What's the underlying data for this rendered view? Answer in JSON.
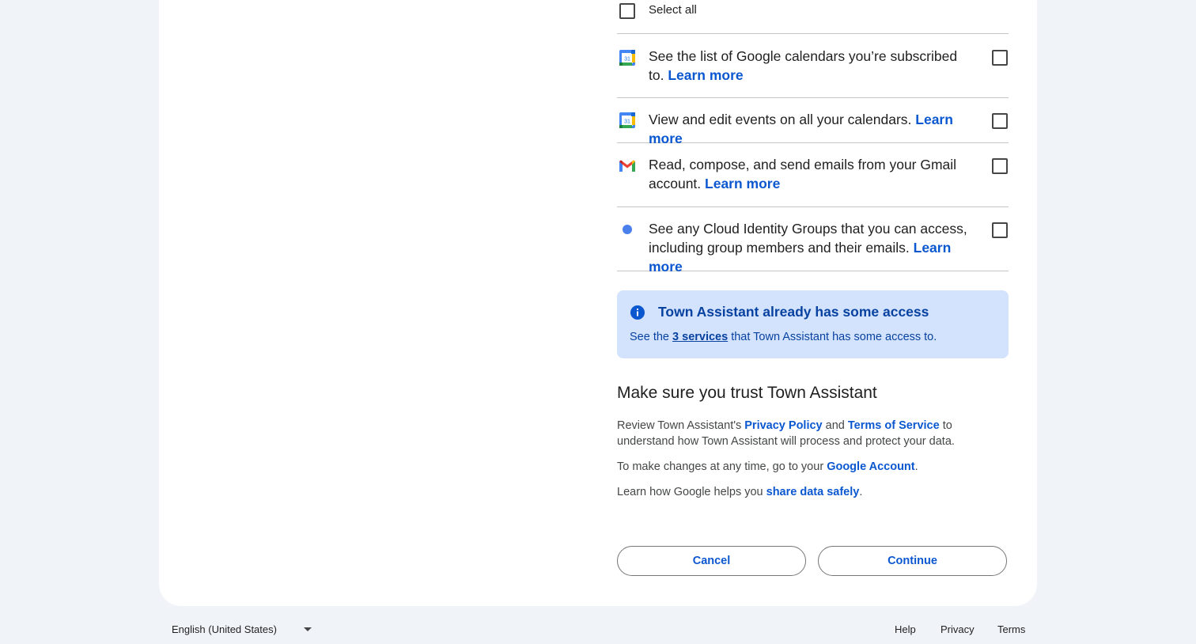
{
  "select_all_label": "Select all",
  "scopes": [
    {
      "text": "See the list of Google calendars you’re subscribed to.",
      "link": "Learn more",
      "icon": "google-calendar-icon"
    },
    {
      "text": "View and edit events on all your calendars.",
      "link": "Learn more",
      "icon": "google-calendar-icon"
    },
    {
      "text": "Read, compose, and send emails from your Gmail account.",
      "link": "Learn more",
      "icon": "gmail-icon"
    },
    {
      "text": "See any Cloud Identity Groups that you can access, including group members and their emails.",
      "link": "Learn more",
      "icon": "blue-dot-icon"
    }
  ],
  "calendar_icon_day": "31",
  "info_box": {
    "title": "Town Assistant already has some access",
    "body_prefix": "See the",
    "body_link": "3 services",
    "body_suffix": "that Town Assistant has some access to."
  },
  "trust": {
    "title": "Make sure you trust Town Assistant",
    "p1_a": "Review Town Assistant's",
    "p1_link1": "Privacy Policy",
    "p1_b": "and",
    "p1_link2": "Terms of Service",
    "p1_c": "to understand how Town Assistant will process and protect your data.",
    "p2_a": "To make changes at any time, go to your",
    "p2_link": "Google Account",
    "p2_b": ".",
    "p3_a": "Learn how Google helps you",
    "p3_link": "share data safely",
    "p3_b": "."
  },
  "buttons": {
    "cancel": "Cancel",
    "continue": "Continue"
  },
  "footer": {
    "language": "English (United States)",
    "help": "Help",
    "privacy": "Privacy",
    "terms": "Terms"
  },
  "colors": {
    "link": "#0b57d0",
    "info_bg": "#d3e3fd",
    "page_bg": "#f0f4f9"
  }
}
